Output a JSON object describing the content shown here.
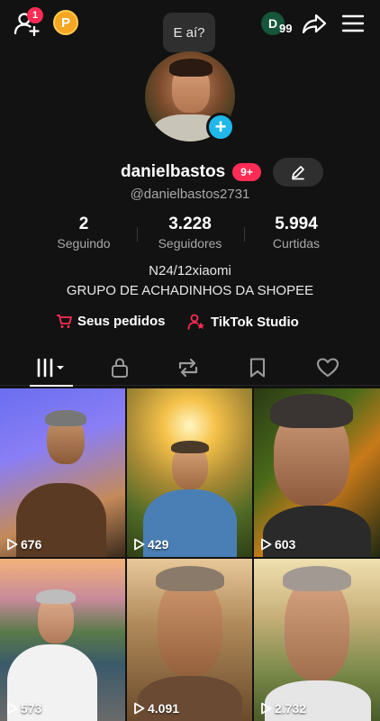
{
  "topbar": {
    "notifications_count": "1",
    "points_label": "P",
    "tooltip": "E aí?",
    "d_badge": "D",
    "d_count": "99"
  },
  "profile": {
    "username": "danielbastos",
    "inbox_badge": "9+",
    "handle": "@danielbastos2731"
  },
  "stats": [
    {
      "value": "2",
      "label": "Seguindo"
    },
    {
      "value": "3.228",
      "label": "Seguidores"
    },
    {
      "value": "5.994",
      "label": "Curtidas"
    }
  ],
  "bio": {
    "line1": "N24/12xiaomi",
    "line2": "GRUPO DE ACHADINHOS DA SHOPEE"
  },
  "links": {
    "orders": "Seus pedidos",
    "studio": "TikTok Studio"
  },
  "tabs": [
    "videos-grid",
    "private",
    "reposts",
    "favorites",
    "liked"
  ],
  "videos": [
    {
      "views": "676"
    },
    {
      "views": "429"
    },
    {
      "views": "603"
    },
    {
      "views": "573"
    },
    {
      "views": "4.091"
    },
    {
      "views": "2.732"
    }
  ],
  "colors": {
    "accent_red": "#fe2c55",
    "avatar_add": "#20b8e8",
    "points": "#f5a623",
    "background": "#121212"
  }
}
